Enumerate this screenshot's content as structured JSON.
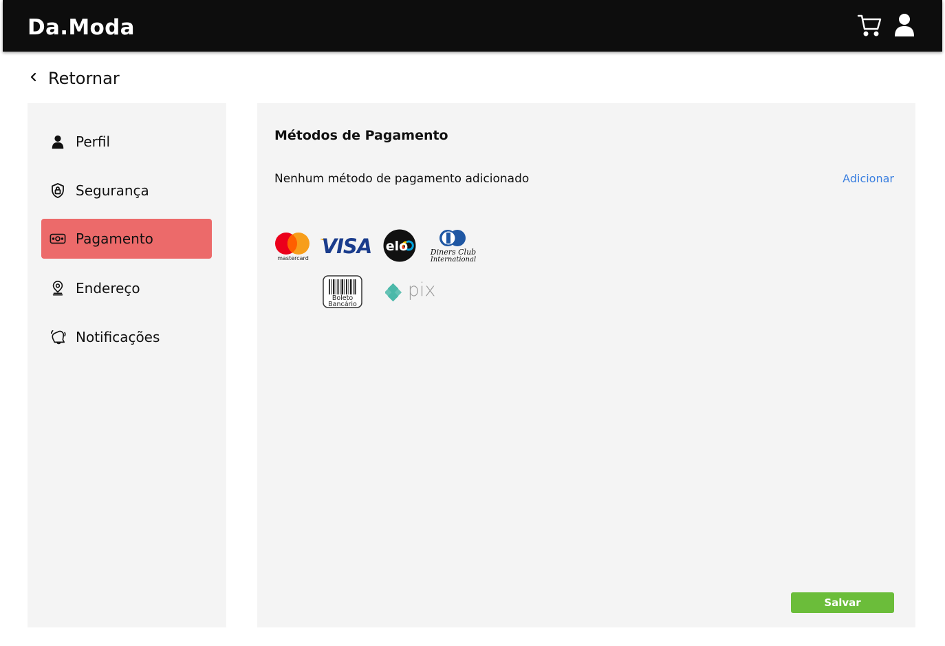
{
  "header": {
    "brand": "Da.Moda",
    "cart_icon": "cart-icon",
    "user_icon": "user-icon"
  },
  "back": {
    "label": "Retornar",
    "icon": "chevron-left-icon"
  },
  "sidebar": {
    "items": [
      {
        "label": "Perfil",
        "icon": "user-icon",
        "active": false
      },
      {
        "label": "Segurança",
        "icon": "shield-lock-icon",
        "active": false
      },
      {
        "label": "Pagamento",
        "icon": "money-icon",
        "active": true
      },
      {
        "label": "Endereço",
        "icon": "location-pin-icon",
        "active": false
      },
      {
        "label": "Notificações",
        "icon": "bell-icon",
        "active": false
      }
    ],
    "active_color": "#ec6a6a"
  },
  "main": {
    "title": "Métodos de Pagamento",
    "empty_message": "Nenhum método de pagamento adicionado",
    "add_label": "Adicionar",
    "save_label": "Salvar",
    "payment_logos": {
      "mastercard": "mastercard",
      "visa": "VISA",
      "elo": "elo",
      "diners_line1": "Diners Club",
      "diners_line2": "International",
      "boleto_line1": "Boleto",
      "boleto_line2": "Bancário",
      "pix": "pix"
    }
  },
  "colors": {
    "topbar": "#0d0d0d",
    "link": "#3a7fe0",
    "save": "#6bbd3a",
    "panel": "#f4f4f4"
  }
}
